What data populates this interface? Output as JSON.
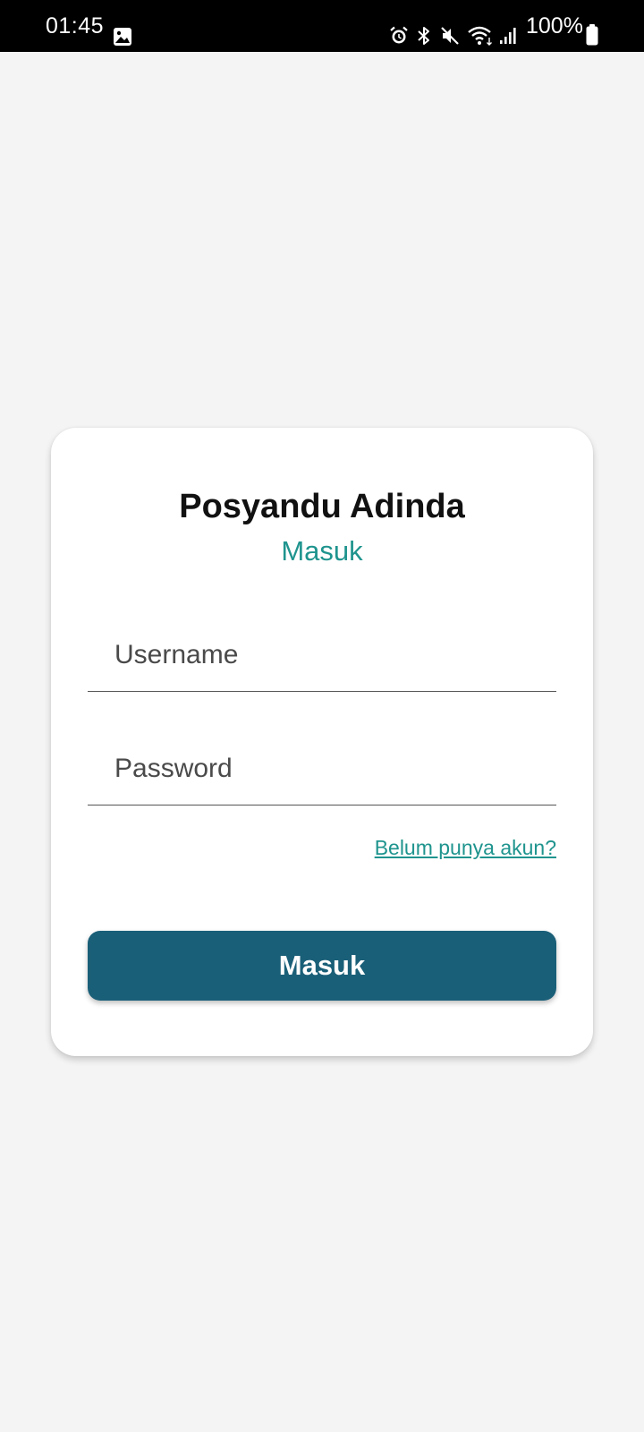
{
  "status_bar": {
    "time": "01:45",
    "battery_text": "100%",
    "icons": [
      "image-icon",
      "alarm-icon",
      "bluetooth-icon",
      "mute-icon",
      "wifi-icon",
      "signal-icon",
      "battery-icon"
    ]
  },
  "login": {
    "title": "Posyandu Adinda",
    "subtitle": "Masuk",
    "username_placeholder": "Username",
    "password_placeholder": "Password",
    "register_link": "Belum punya akun?",
    "submit_label": "Masuk"
  },
  "colors": {
    "background": "#f4f4f4",
    "accent": "#1f948e",
    "button": "#1a5f78",
    "card": "#ffffff"
  }
}
